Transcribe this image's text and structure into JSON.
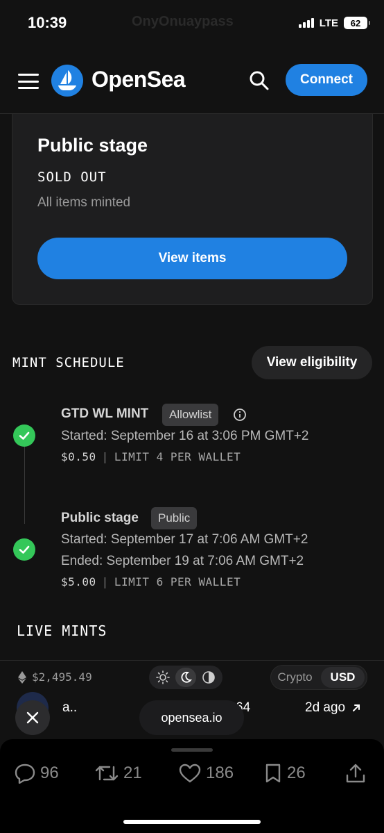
{
  "status_bar": {
    "time": "10:39",
    "network": "LTE",
    "battery": "62",
    "ghost_text": "OnyOnuaypass"
  },
  "header": {
    "brand": "OpenSea",
    "connect_label": "Connect"
  },
  "stage_card": {
    "title": "Public stage",
    "status": "SOLD OUT",
    "subtitle": "All items minted",
    "button_label": "View items"
  },
  "mint_schedule": {
    "heading": "MINT SCHEDULE",
    "eligibility_label": "View eligibility",
    "stages": [
      {
        "name": "GTD WL MINT",
        "tag": "Allowlist",
        "started": "Started: September 16 at 3:06 PM GMT+2",
        "price": "$0.50",
        "limit": "LIMIT 4 PER WALLET"
      },
      {
        "name": "Public stage",
        "tag": "Public",
        "started": "Started: September 17 at 7:06 AM GMT+2",
        "ended": "Ended: September 19 at 7:06 AM GMT+2",
        "price": "$5.00",
        "limit": "LIMIT 6 PER WALLET"
      }
    ]
  },
  "live_mints": {
    "heading": "LIVE MINTS"
  },
  "footer_bar": {
    "eth_price": "$2,495.49",
    "currency_options": [
      "Crypto",
      "USD"
    ],
    "selected_currency": "USD"
  },
  "activity": {
    "name": "a..",
    "number": "64",
    "time": "2d ago"
  },
  "browser": {
    "url": "opensea.io"
  },
  "tweet_actions": {
    "replies": "96",
    "retweets": "21",
    "likes": "186",
    "bookmarks": "26"
  },
  "colors": {
    "accent": "#2081e2",
    "success": "#34c759",
    "background": "#121212"
  }
}
